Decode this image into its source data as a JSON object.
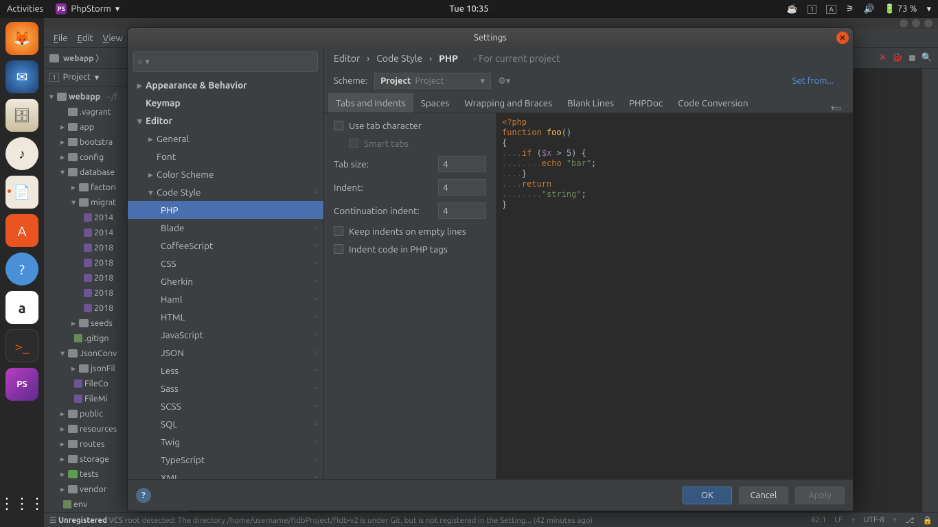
{
  "gnome": {
    "activities": "Activities",
    "app": "PhpStorm",
    "clock": "Tue 10:35",
    "battery": "73 %"
  },
  "ide": {
    "menu": [
      "File",
      "Edit",
      "View"
    ],
    "breadcrumb": "webapp",
    "project_label": "Project",
    "tree": {
      "root": "webapp",
      "root_suffix": "~/f",
      "items": [
        ".vagrant",
        "app",
        "bootstra",
        "config",
        "database",
        "factori",
        "migrat",
        "2014",
        "2014",
        "2018",
        "2018",
        "2018",
        "2018",
        "2018",
        "seeds",
        ".gitign",
        "JsonConv",
        "jsonFil",
        "FileCo",
        "FileMi",
        "public",
        "resources",
        "routes",
        "storage",
        "tests",
        "vendor",
        "env"
      ]
    },
    "status": {
      "left_strong": "Unregistered",
      "left": " VCS root detected: The directory /home/username/fldbProject/fldb-v2 is under Git, but is not registered in the Setting... (42 minutes ago)",
      "pos": "82:1",
      "lf": "LF",
      "enc": "UTF-8"
    }
  },
  "dialog": {
    "title": "Settings",
    "search_icon": "⌕",
    "left": {
      "appearance": "Appearance & Behavior",
      "keymap": "Keymap",
      "editor": "Editor",
      "general": "General",
      "font": "Font",
      "colorscheme": "Color Scheme",
      "codestyle": "Code Style",
      "langs": [
        "PHP",
        "Blade",
        "CoffeeScript",
        "CSS",
        "Gherkin",
        "Haml",
        "HTML",
        "JavaScript",
        "JSON",
        "Less",
        "Sass",
        "SCSS",
        "SQL",
        "Twig",
        "TypeScript",
        "XML"
      ]
    },
    "crumb": {
      "a": "Editor",
      "b": "Code Style",
      "c": "PHP",
      "scope": "For current project"
    },
    "scheme": {
      "label": "Scheme:",
      "strong": "Project",
      "suffix": "Project",
      "setfrom": "Set from..."
    },
    "tabs": [
      "Tabs and Indents",
      "Spaces",
      "Wrapping and Braces",
      "Blank Lines",
      "PHPDoc",
      "Code Conversion"
    ],
    "opts": {
      "use_tab": "Use tab character",
      "smart": "Smart tabs",
      "tabsize_l": "Tab size:",
      "tabsize_v": "4",
      "indent_l": "Indent:",
      "indent_v": "4",
      "cont_l": "Continuation indent:",
      "cont_v": "4",
      "keep": "Keep indents on empty lines",
      "intags": "Indent code in PHP tags"
    },
    "preview": {
      "l1a": "<?php",
      "l2a": "function ",
      "l2b": "foo",
      "l2c": "()",
      "l3": "{",
      "l4a": "....",
      "l4b": "if ",
      "l4c": "(",
      "l4d": "$x",
      "l4e": " > ",
      "l4f": "5",
      "l4g": ") {",
      "l5a": "........",
      "l5b": "echo ",
      "l5c": "\"bar\"",
      "l5d": ";",
      "l6a": "....",
      "l6b": "}",
      "l7a": "....",
      "l7b": "return",
      "l8a": "........",
      "l8b": "\"string\"",
      "l8c": ";",
      "l9": "}"
    },
    "buttons": {
      "ok": "OK",
      "cancel": "Cancel",
      "apply": "Apply"
    }
  }
}
